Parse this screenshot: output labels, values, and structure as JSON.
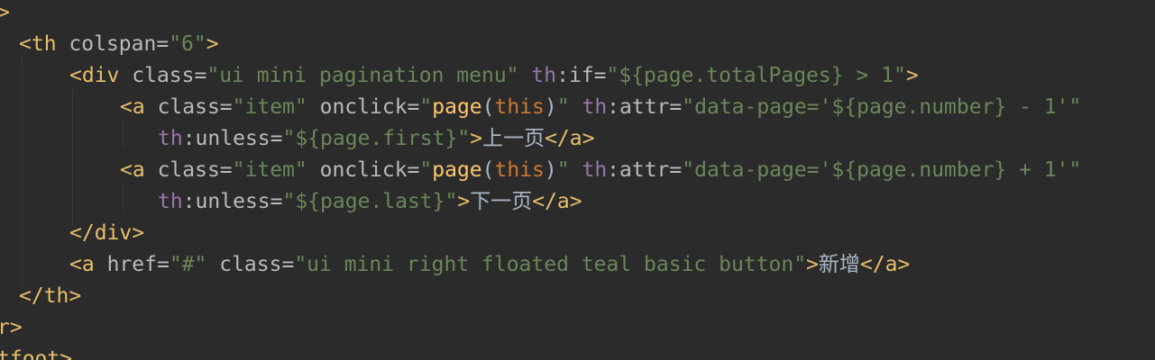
{
  "code": {
    "l1_close": ">",
    "l2": {
      "open": "<th",
      "colspan_attr": "colspan=",
      "colspan_val": "\"6\"",
      "end": ">"
    },
    "l3": {
      "open": "<div",
      "class_attr": "class=",
      "class_val": "\"ui mini pagination menu\"",
      "ns": "th",
      "if_attr": ":if=",
      "if_val": "\"${page.totalPages} > 1\"",
      "end": ">"
    },
    "l4": {
      "open": "<a",
      "class_attr": "class=",
      "class_val": "\"item\"",
      "onclick_attr": "onclick=",
      "q_open": "\"",
      "fn": "page",
      "paren_open": "(",
      "this_kw": "this",
      "paren_close": ")",
      "q_close": "\"",
      "ns": "th",
      "attr_attr": ":attr=",
      "attr_val": "\"data-page='${page.number} - 1'\""
    },
    "l5": {
      "ns": "th",
      "unless_attr": ":unless=",
      "unless_val": "\"${page.first}\"",
      "end": ">",
      "text": "上一页",
      "close": "</a>"
    },
    "l6": {
      "open": "<a",
      "class_attr": "class=",
      "class_val": "\"item\"",
      "onclick_attr": "onclick=",
      "q_open": "\"",
      "fn": "page",
      "paren_open": "(",
      "this_kw": "this",
      "paren_close": ")",
      "q_close": "\"",
      "ns": "th",
      "attr_attr": ":attr=",
      "attr_val": "\"data-page='${page.number} + 1'\""
    },
    "l7": {
      "ns": "th",
      "unless_attr": ":unless=",
      "unless_val": "\"${page.last}\"",
      "end": ">",
      "text": "下一页",
      "close": "</a>"
    },
    "l8": {
      "close": "</div>"
    },
    "l9": {
      "open": "<a",
      "href_attr": "href=",
      "href_val": "\"#\"",
      "class_attr": "class=",
      "class_val": "\"ui mini right floated teal basic button\"",
      "end": ">",
      "text": "新增",
      "close": "</a>"
    },
    "l10": {
      "close": "</th>"
    },
    "l11": {
      "close": "r>"
    },
    "l12": {
      "close": "tfoot>"
    }
  }
}
